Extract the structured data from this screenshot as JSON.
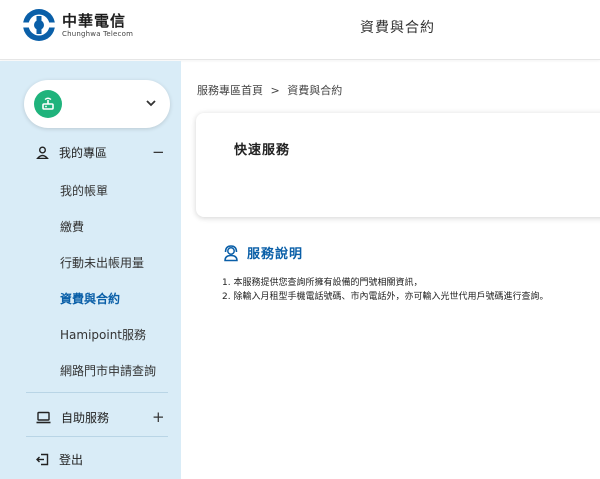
{
  "header": {
    "logo_cn": "中華電信",
    "logo_en": "Chunghwa Telecom",
    "title": "資費與合約",
    "brand_color": "#0a5fa8"
  },
  "sidebar": {
    "account": {
      "name": "",
      "avatar_icon": "modem-icon",
      "avatar_color": "#1fb37c"
    },
    "my_area": {
      "label": "我的專區",
      "toggle": "−",
      "items": [
        {
          "label": "我的帳單",
          "active": false
        },
        {
          "label": "繳費",
          "active": false
        },
        {
          "label": "行動未出帳用量",
          "active": false
        },
        {
          "label": "資費與合約",
          "active": true
        },
        {
          "label": "Hamipoint服務",
          "active": false
        },
        {
          "label": "網路門市申請查詢",
          "active": false
        }
      ]
    },
    "self_service": {
      "label": "自助服務",
      "toggle": "+"
    },
    "logout": {
      "label": "登出"
    },
    "background": "#d9ecf7"
  },
  "breadcrumb": {
    "home": "服務專區首頁",
    "separator": ">",
    "current": "資費與合約"
  },
  "quick_service": {
    "title": "快速服務"
  },
  "service_info": {
    "title": "服務說明",
    "items": [
      "1. 本服務提供您查詢所擁有設備的門號相關資訊，",
      "2. 除輸入月租型手機電話號碼、市內電話外，亦可輸入光世代用戶號碼進行查詢。"
    ]
  }
}
